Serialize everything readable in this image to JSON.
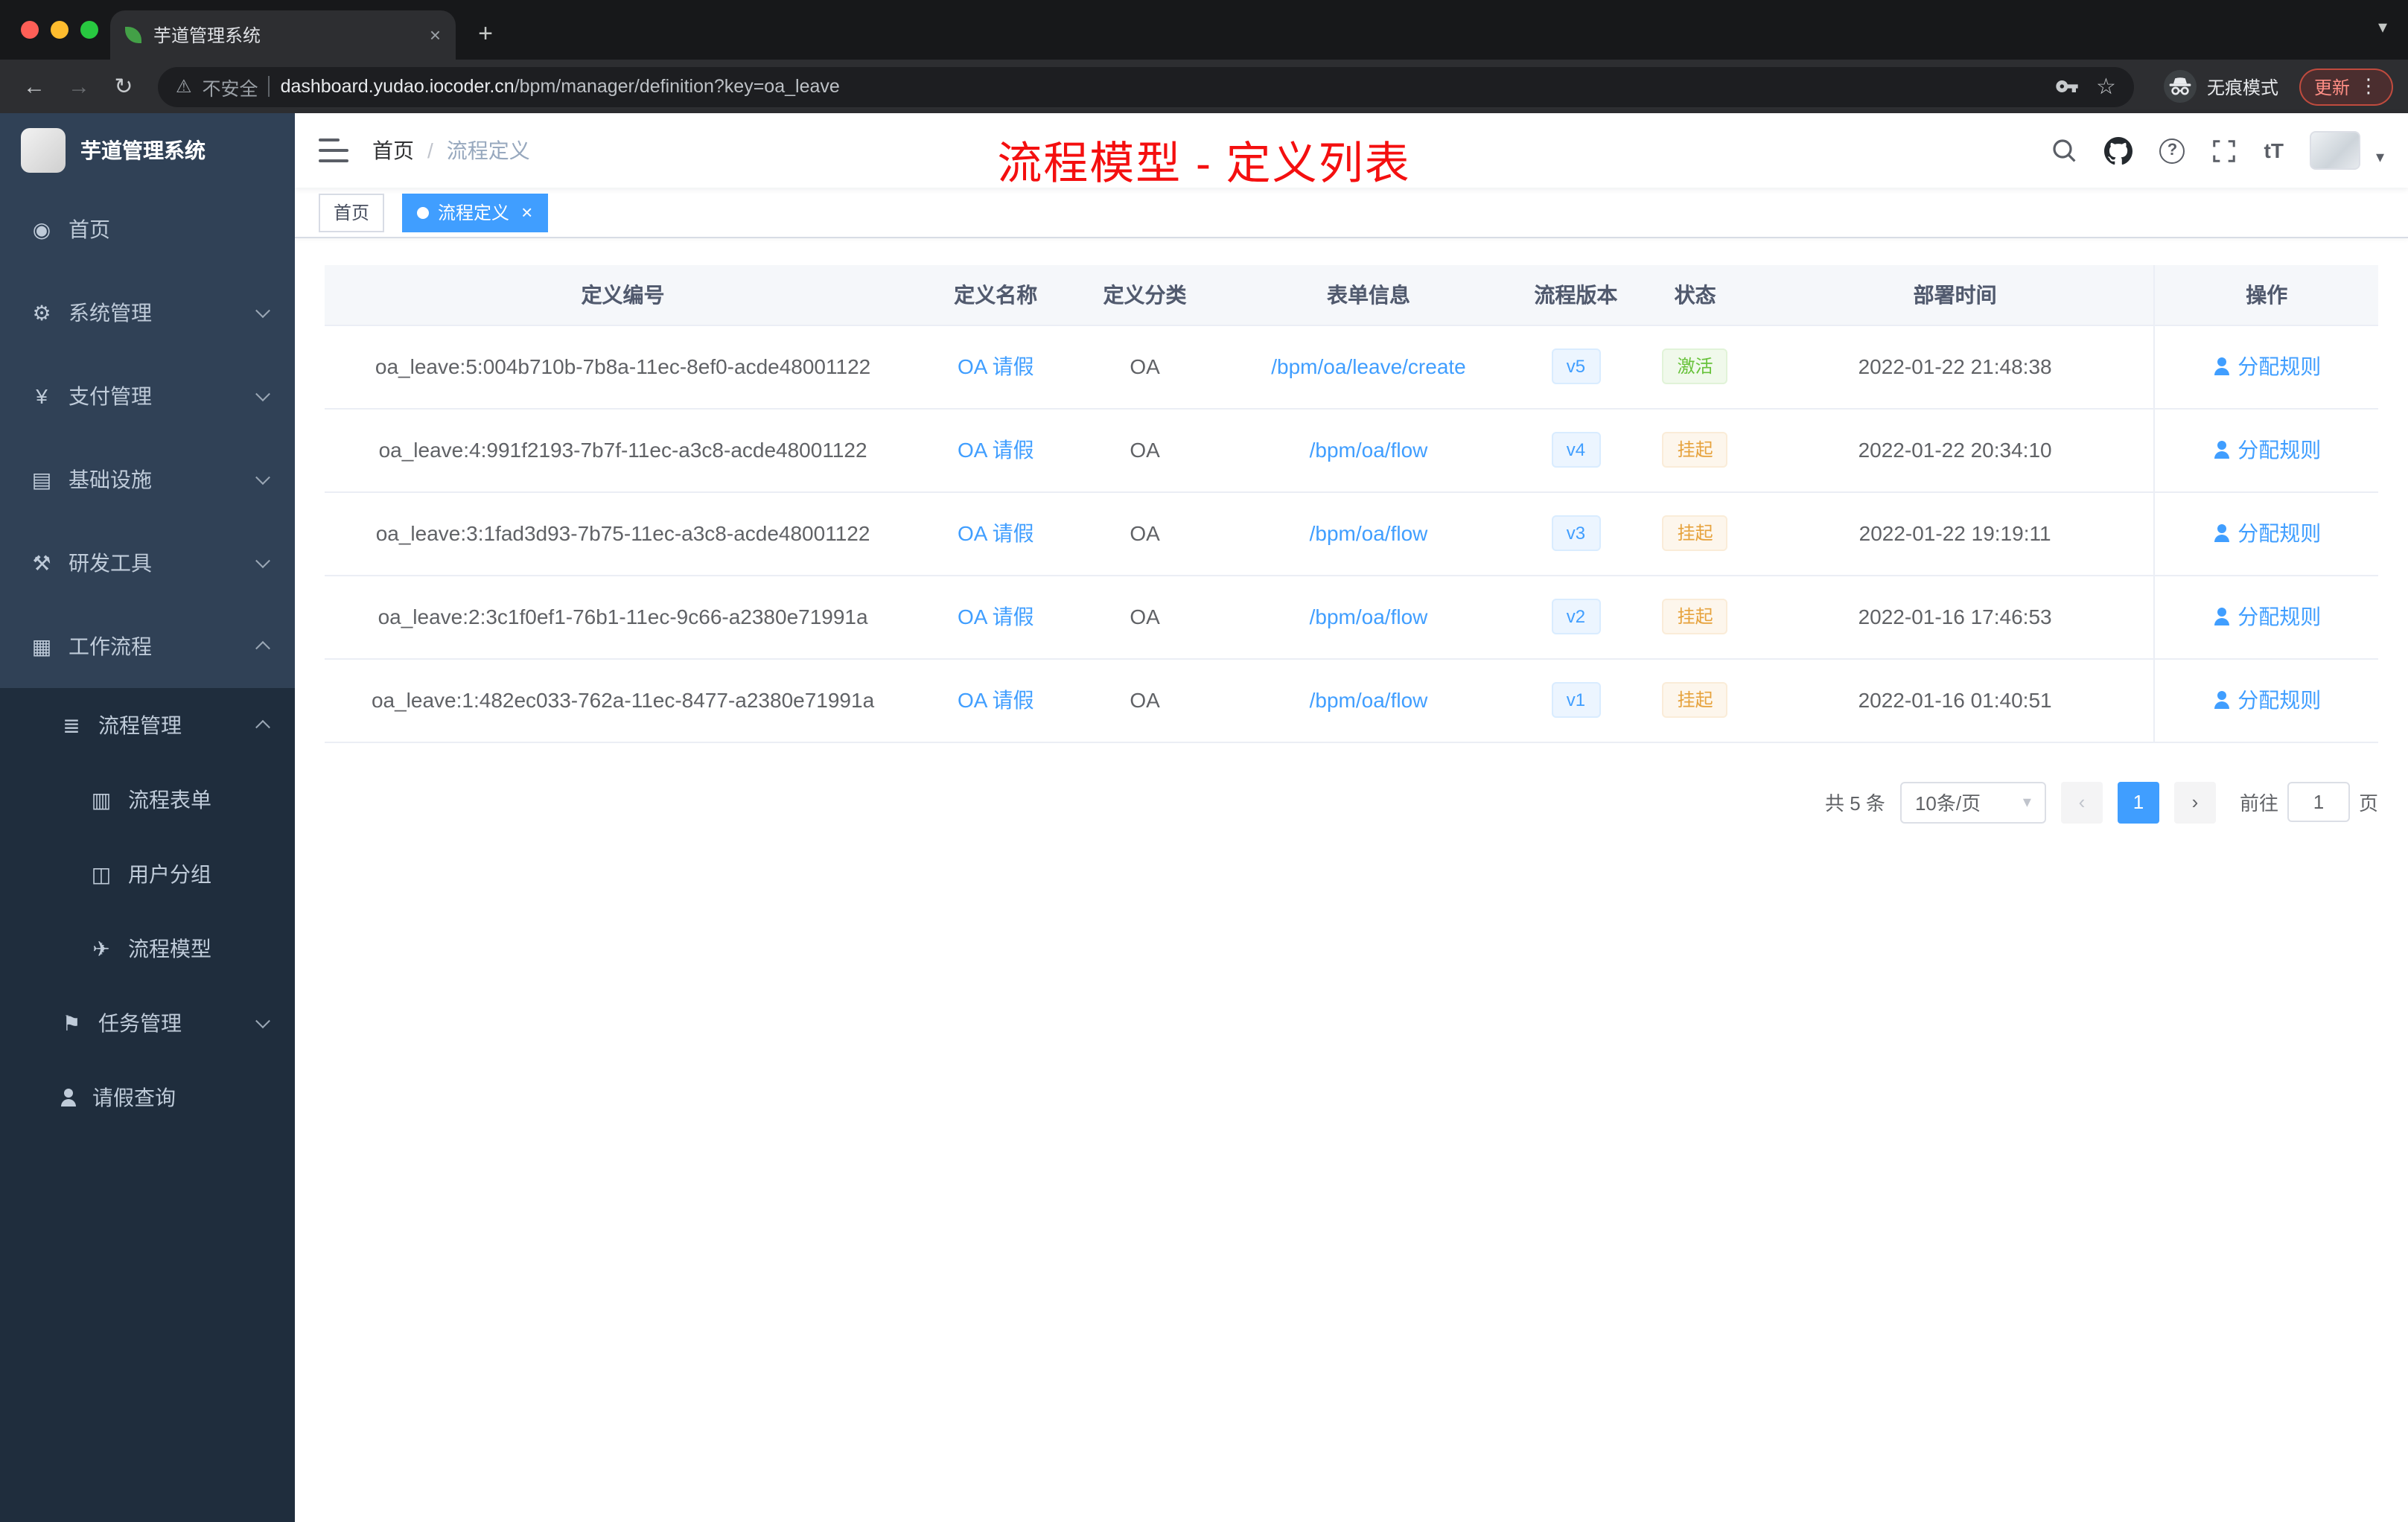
{
  "colors": {
    "accent": "#409eff",
    "success": "#67c23a",
    "warning": "#e6a23c",
    "annotation": "#f40f0f",
    "sidebar_bg": "#304156",
    "sidebar_sub_bg": "#1f2d3d"
  },
  "icons": {
    "dashboard": "◉",
    "gear": "⚙",
    "yen": "¥",
    "infrastructure": "▤",
    "dev-tools": "⚒",
    "workflow": "▦",
    "process-manage": "≣",
    "form": "▥",
    "user-group": "◫",
    "process-model": "✈",
    "task": "⚑",
    "leave-query": "css-person",
    "back": "←",
    "forward": "→",
    "reload": "↻",
    "warning_triangle": "⚠",
    "star": "☆",
    "kebab": "⋮",
    "plus": "+",
    "chevron_down": "▾",
    "caret_down": "▾",
    "question": "?",
    "font_size": "tT",
    "close": "×",
    "prev": "‹",
    "next": "›"
  },
  "browser": {
    "tab_title": "芋道管理系统",
    "security_label": "不安全",
    "url_host": "dashboard.yudao.iocoder.cn",
    "url_path": "/bpm/manager/definition?key=oa_leave",
    "incognito_label": "无痕模式",
    "update_label": "更新"
  },
  "sidebar": {
    "app_title": "芋道管理系统",
    "items": [
      {
        "key": "home",
        "label": "首页",
        "level": 1,
        "icon": "dashboard"
      },
      {
        "key": "system",
        "label": "系统管理",
        "level": 1,
        "icon": "gear",
        "chevron": "down"
      },
      {
        "key": "payment",
        "label": "支付管理",
        "level": 1,
        "icon": "yen",
        "chevron": "down"
      },
      {
        "key": "infrastructure",
        "label": "基础设施",
        "level": 1,
        "icon": "infrastructure",
        "chevron": "down"
      },
      {
        "key": "dev-tools",
        "label": "研发工具",
        "level": 1,
        "icon": "dev-tools",
        "chevron": "down"
      },
      {
        "key": "workflow",
        "label": "工作流程",
        "level": 1,
        "icon": "workflow",
        "chevron": "up"
      },
      {
        "key": "process-manage",
        "label": "流程管理",
        "level": 2,
        "icon": "process-manage",
        "chevron": "up"
      },
      {
        "key": "process-form",
        "label": "流程表单",
        "level": 3,
        "icon": "form"
      },
      {
        "key": "user-group",
        "label": "用户分组",
        "level": 3,
        "icon": "user-group"
      },
      {
        "key": "process-model",
        "label": "流程模型",
        "level": 3,
        "icon": "process-model"
      },
      {
        "key": "task-manage",
        "label": "任务管理",
        "level": 2,
        "icon": "task",
        "chevron": "down"
      },
      {
        "key": "leave-query",
        "label": "请假查询",
        "level": 2,
        "icon": "leave-query"
      }
    ]
  },
  "header": {
    "breadcrumb_home": "首页",
    "breadcrumb_sep": "/",
    "breadcrumb_current": "流程定义",
    "annotation": "流程模型 - 定义列表"
  },
  "tags": [
    {
      "label": "首页",
      "active": false
    },
    {
      "label": "流程定义",
      "active": true
    }
  ],
  "table": {
    "columns": [
      "定义编号",
      "定义名称",
      "定义分类",
      "表单信息",
      "流程版本",
      "状态",
      "部署时间",
      "操作"
    ],
    "rows": [
      {
        "id": "oa_leave:5:004b710b-7b8a-11ec-8ef0-acde48001122",
        "name": "OA 请假",
        "category": "OA",
        "form": "/bpm/oa/leave/create",
        "version": "v5",
        "status": "激活",
        "status_type": "success",
        "time": "2022-01-22 21:48:38",
        "action": "分配规则"
      },
      {
        "id": "oa_leave:4:991f2193-7b7f-11ec-a3c8-acde48001122",
        "name": "OA 请假",
        "category": "OA",
        "form": "/bpm/oa/flow",
        "version": "v4",
        "status": "挂起",
        "status_type": "warning",
        "time": "2022-01-22 20:34:10",
        "action": "分配规则"
      },
      {
        "id": "oa_leave:3:1fad3d93-7b75-11ec-a3c8-acde48001122",
        "name": "OA 请假",
        "category": "OA",
        "form": "/bpm/oa/flow",
        "version": "v3",
        "status": "挂起",
        "status_type": "warning",
        "time": "2022-01-22 19:19:11",
        "action": "分配规则"
      },
      {
        "id": "oa_leave:2:3c1f0ef1-76b1-11ec-9c66-a2380e71991a",
        "name": "OA 请假",
        "category": "OA",
        "form": "/bpm/oa/flow",
        "version": "v2",
        "status": "挂起",
        "status_type": "warning",
        "time": "2022-01-16 17:46:53",
        "action": "分配规则"
      },
      {
        "id": "oa_leave:1:482ec033-762a-11ec-8477-a2380e71991a",
        "name": "OA 请假",
        "category": "OA",
        "form": "/bpm/oa/flow",
        "version": "v1",
        "status": "挂起",
        "status_type": "warning",
        "time": "2022-01-16 01:40:51",
        "action": "分配规则"
      }
    ]
  },
  "pagination": {
    "total_label": "共 5 条",
    "page_size": "10条/页",
    "current_page": "1",
    "goto_label": "前往",
    "goto_value": "1",
    "unit_label": "页"
  }
}
